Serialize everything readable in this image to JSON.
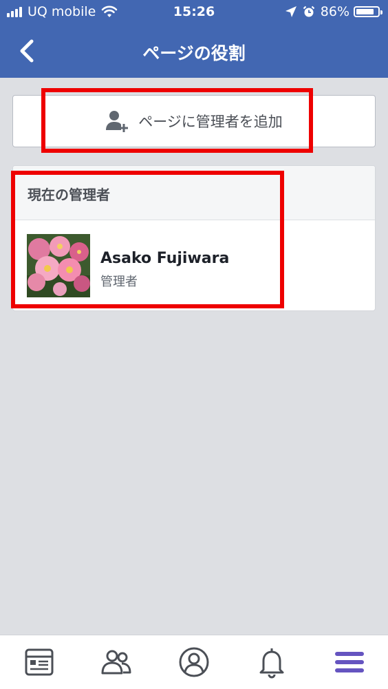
{
  "status_bar": {
    "carrier": "UQ mobile",
    "time": "15:26",
    "battery_percent": "86%",
    "battery_level": 0.86,
    "icons": [
      "signal-bars-icon",
      "wifi-icon",
      "location-arrow-icon",
      "alarm-clock-icon",
      "battery-icon"
    ]
  },
  "header": {
    "title": "ページの役割",
    "back_icon": "chevron-left-icon"
  },
  "add_admin": {
    "label": "ページに管理者を追加",
    "icon": "add-person-icon"
  },
  "current_admins": {
    "heading": "現在の管理者",
    "items": [
      {
        "name": "Asako Fujiwara",
        "role": "管理者",
        "avatar": "pink-flowers-photo"
      }
    ]
  },
  "tab_bar": {
    "tabs": [
      {
        "icon": "news-feed-icon",
        "active": false
      },
      {
        "icon": "friends-icon",
        "active": false
      },
      {
        "icon": "profile-icon",
        "active": false
      },
      {
        "icon": "notifications-bell-icon",
        "active": false
      },
      {
        "icon": "menu-icon",
        "active": true
      }
    ]
  },
  "colors": {
    "header_bg": "#4267b2",
    "page_bg": "#dddfe3",
    "highlight": "#ee0000",
    "active_tab": "#6554c0",
    "inactive_tab": "#4b4f56"
  }
}
